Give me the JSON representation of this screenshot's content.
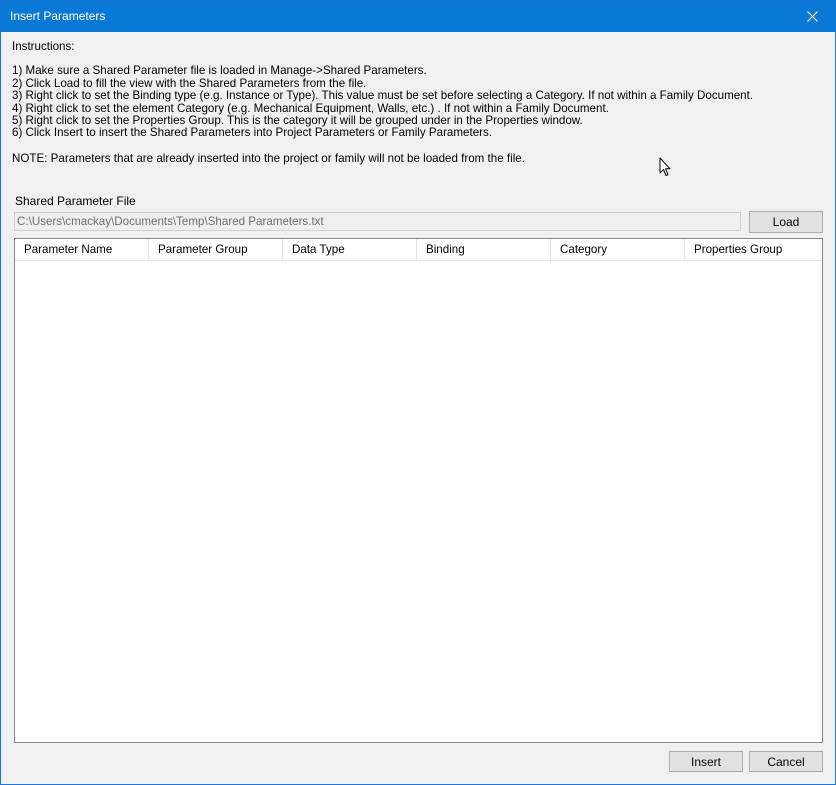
{
  "window": {
    "title": "Insert Parameters",
    "close_icon": "close-icon"
  },
  "instructions": {
    "heading": "Instructions:",
    "lines": [
      "1) Make sure a Shared Parameter file is loaded in Manage->Shared Parameters.",
      "2) Click Load to fill the view with the Shared Parameters from the file.",
      "3) Right click to set the Binding type (e.g. Instance or Type). This value must be set before selecting a Category. If not within a Family Document.",
      "4) Right click to set the element Category (e.g. Mechanical Equipment, Walls, etc.) . If not within a Family Document.",
      "5) Right click to set the Properties Group. This is the category it will be grouped under in the Properties window.",
      "6) Click Insert to insert the Shared Parameters into Project Parameters or Family Parameters."
    ],
    "note": "NOTE: Parameters that are already inserted into the project or family will not be loaded from the file."
  },
  "shared_file": {
    "label": "Shared Parameter File",
    "value": "C:\\Users\\cmackay\\Documents\\Temp\\Shared Parameters.txt",
    "load_label": "Load"
  },
  "table": {
    "columns": [
      "Parameter Name",
      "Parameter Group",
      "Data Type",
      "Binding",
      "Category",
      "Properties Group"
    ],
    "rows": []
  },
  "footer": {
    "insert_label": "Insert",
    "cancel_label": "Cancel"
  },
  "colors": {
    "titlebar": "#0a78d7",
    "window_bg": "#f0f0f0",
    "button_bg": "#e1e1e1"
  }
}
